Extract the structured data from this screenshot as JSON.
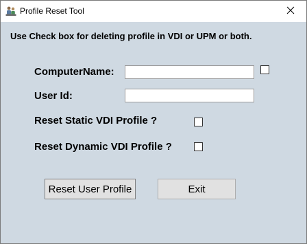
{
  "window": {
    "title": "Profile Reset Tool",
    "icon": "people-icon",
    "close_glyph": "✕"
  },
  "form": {
    "instructions": "Use Check box for deleting profile in VDI or UPM or both.",
    "computer_name_label": "ComputerName:",
    "computer_name_value": "",
    "computer_name_checkbox_checked": false,
    "user_id_label": "User Id:",
    "user_id_value": "",
    "static_vdi_label": "Reset Static VDI Profile ?",
    "static_vdi_checked": false,
    "dynamic_vdi_label": "Reset Dynamic VDI Profile ?",
    "dynamic_vdi_checked": false
  },
  "buttons": {
    "reset_label": "Reset User Profile",
    "exit_label": "Exit"
  }
}
